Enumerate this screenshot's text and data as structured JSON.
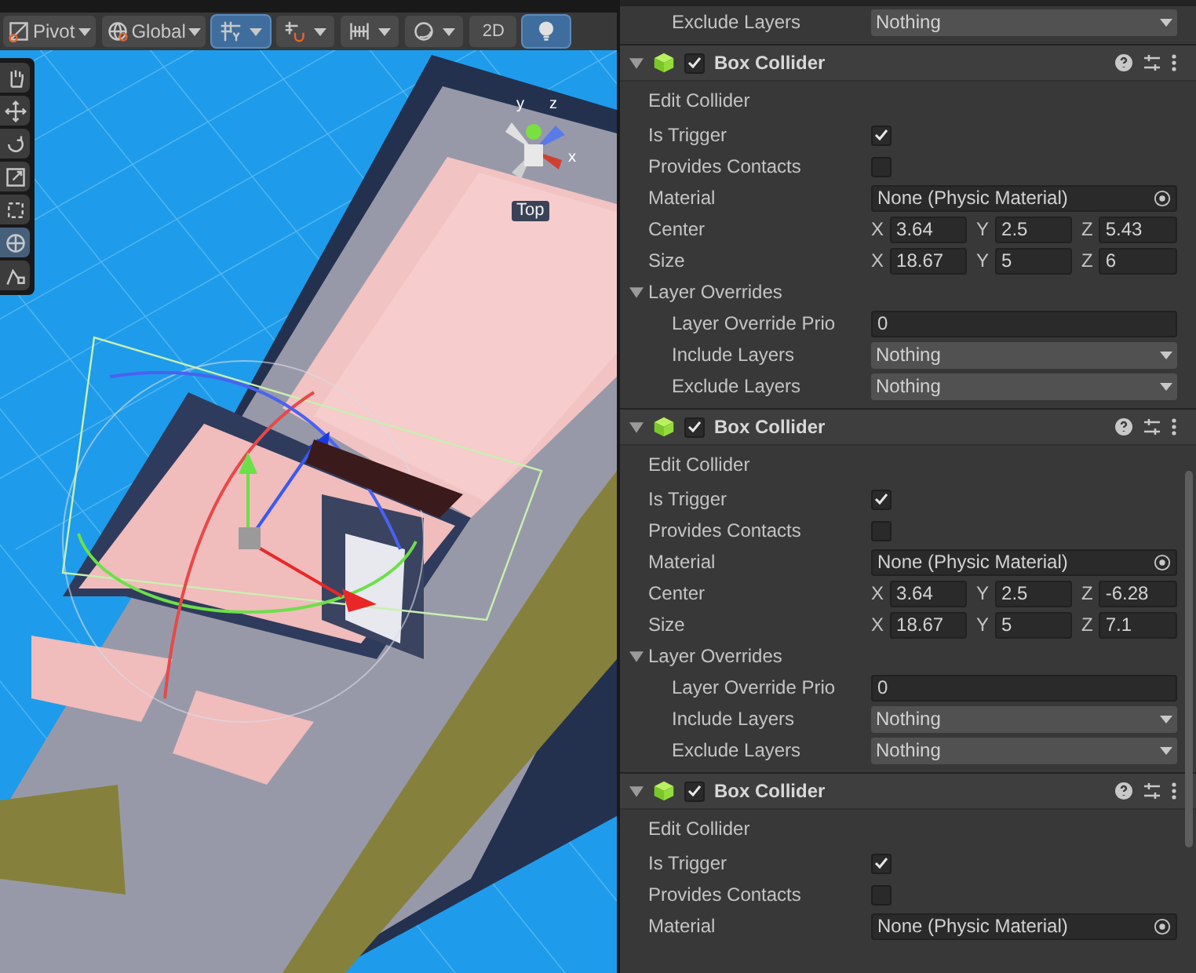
{
  "toolbar": [
    {
      "kind": "dropdown",
      "label": "Pivot",
      "selected": false
    },
    {
      "kind": "dropdown",
      "label": "Global",
      "selected": false
    },
    {
      "kind": "split",
      "selected": true
    },
    {
      "kind": "split",
      "selected": false
    },
    {
      "kind": "split",
      "selected": false
    },
    {
      "kind": "split",
      "selected": false
    },
    {
      "kind": "button",
      "label": "2D",
      "selected": false
    },
    {
      "kind": "button",
      "selected": true
    }
  ],
  "tools": [
    {
      "selected": false
    },
    {
      "selected": false
    },
    {
      "selected": false
    },
    {
      "selected": false
    },
    {
      "selected": false
    },
    {
      "selected": true
    },
    {
      "selected": false
    }
  ],
  "gizmo": {
    "y": "y",
    "z": "z",
    "x": "x",
    "view": "Top"
  },
  "top_row": {
    "label": "Exclude Layers",
    "value": "Nothing"
  },
  "components": [
    {
      "title": "Box Collider",
      "enabled": true,
      "expanded": true,
      "rows": [
        {
          "kind": "button",
          "label": "Edit Collider"
        },
        {
          "kind": "checkbox",
          "label": "Is Trigger",
          "checked": true
        },
        {
          "kind": "checkbox",
          "label": "Provides Contacts",
          "checked": false
        },
        {
          "kind": "object",
          "label": "Material",
          "value": "None (Physic Material)"
        },
        {
          "kind": "vector",
          "label": "Center",
          "axes": [
            {
              "axis": "X",
              "value": "3.64"
            },
            {
              "axis": "Y",
              "value": "2.5"
            },
            {
              "axis": "Z",
              "value": "5.43"
            }
          ]
        },
        {
          "kind": "vector",
          "label": "Size",
          "axes": [
            {
              "axis": "X",
              "value": "18.67"
            },
            {
              "axis": "Y",
              "value": "5"
            },
            {
              "axis": "Z",
              "value": "6"
            }
          ]
        },
        {
          "kind": "foldout",
          "label": "Layer Overrides",
          "expanded": true,
          "children": [
            {
              "kind": "number",
              "label": "Layer Override Prio",
              "value": "0"
            },
            {
              "kind": "dropdown",
              "label": "Include Layers",
              "value": "Nothing"
            },
            {
              "kind": "dropdown",
              "label": "Exclude Layers",
              "value": "Nothing"
            }
          ]
        }
      ]
    },
    {
      "title": "Box Collider",
      "enabled": true,
      "expanded": true,
      "rows": [
        {
          "kind": "button",
          "label": "Edit Collider"
        },
        {
          "kind": "checkbox",
          "label": "Is Trigger",
          "checked": true
        },
        {
          "kind": "checkbox",
          "label": "Provides Contacts",
          "checked": false
        },
        {
          "kind": "object",
          "label": "Material",
          "value": "None (Physic Material)"
        },
        {
          "kind": "vector",
          "label": "Center",
          "axes": [
            {
              "axis": "X",
              "value": "3.64"
            },
            {
              "axis": "Y",
              "value": "2.5"
            },
            {
              "axis": "Z",
              "value": "-6.28"
            }
          ]
        },
        {
          "kind": "vector",
          "label": "Size",
          "axes": [
            {
              "axis": "X",
              "value": "18.67"
            },
            {
              "axis": "Y",
              "value": "5"
            },
            {
              "axis": "Z",
              "value": "7.1"
            }
          ]
        },
        {
          "kind": "foldout",
          "label": "Layer Overrides",
          "expanded": true,
          "children": [
            {
              "kind": "number",
              "label": "Layer Override Prio",
              "value": "0"
            },
            {
              "kind": "dropdown",
              "label": "Include Layers",
              "value": "Nothing"
            },
            {
              "kind": "dropdown",
              "label": "Exclude Layers",
              "value": "Nothing"
            }
          ]
        }
      ]
    },
    {
      "title": "Box Collider",
      "enabled": true,
      "expanded": true,
      "rows": [
        {
          "kind": "button",
          "label": "Edit Collider"
        },
        {
          "kind": "checkbox",
          "label": "Is Trigger",
          "checked": true
        },
        {
          "kind": "checkbox",
          "label": "Provides Contacts",
          "checked": false
        },
        {
          "kind": "object",
          "label": "Material",
          "value": "None (Physic Material)"
        }
      ]
    }
  ]
}
